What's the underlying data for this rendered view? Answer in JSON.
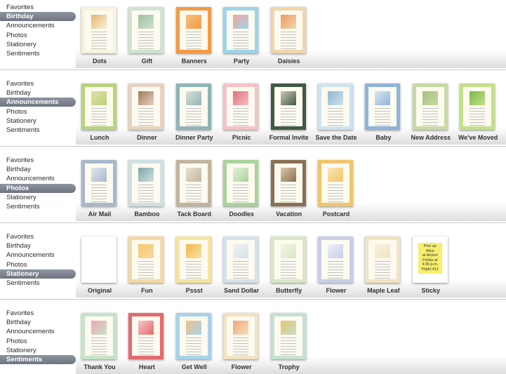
{
  "rows": [
    {
      "categories": [
        "Favorites",
        "Birthday",
        "Announcements",
        "Photos",
        "Stationery",
        "Sentiments"
      ],
      "selected": 1,
      "templates": [
        {
          "label": "Dots",
          "bg": "#f7f2dd",
          "accent": "#e8b36c"
        },
        {
          "label": "Gift",
          "bg": "#cfe3d2",
          "accent": "#9cbfa3"
        },
        {
          "label": "Banners",
          "bg": "#f39a44",
          "accent": "#f6c27a"
        },
        {
          "label": "Party",
          "bg": "#9fd4e8",
          "accent": "#f2a7a0"
        },
        {
          "label": "Daisies",
          "bg": "#f1d6ad",
          "accent": "#e89b63"
        }
      ]
    },
    {
      "categories": [
        "Favorites",
        "Birthday",
        "Announcements",
        "Photos",
        "Stationery",
        "Sentiments"
      ],
      "selected": 2,
      "templates": [
        {
          "label": "Lunch",
          "bg": "#b7d47d",
          "accent": "#e8dca8"
        },
        {
          "label": "Dinner",
          "bg": "#e7d2c0",
          "accent": "#9e7a5b"
        },
        {
          "label": "Dinner Party",
          "bg": "#8fb4b7",
          "accent": "#d9e2d8"
        },
        {
          "label": "Picnic",
          "bg": "#f3c3c6",
          "accent": "#e26e7a"
        },
        {
          "label": "Formal Invite",
          "bg": "#3f5a46",
          "accent": "#cfc9b8"
        },
        {
          "label": "Save the Date",
          "bg": "#cfe3ee",
          "accent": "#8fb6cc"
        },
        {
          "label": "Baby",
          "bg": "#8eb5d8",
          "accent": "#d8e6f2"
        },
        {
          "label": "New Address",
          "bg": "#c8d9a6",
          "accent": "#a6c07a"
        },
        {
          "label": "We've Moved",
          "bg": "#c4e08a",
          "accent": "#79b94a"
        }
      ]
    },
    {
      "categories": [
        "Favorites",
        "Birthday",
        "Announcements",
        "Photos",
        "Stationery",
        "Sentiments"
      ],
      "selected": 3,
      "templates": [
        {
          "label": "Air Mail",
          "bg": "#a7b8cc",
          "accent": "#e0e6ee"
        },
        {
          "label": "Bamboo",
          "bg": "#cfe0e2",
          "accent": "#7fa7a8"
        },
        {
          "label": "Tack Board",
          "bg": "#c3b49d",
          "accent": "#e9e2d3"
        },
        {
          "label": "Doodles",
          "bg": "#a8d39a",
          "accent": "#e7f0db"
        },
        {
          "label": "Vacation",
          "bg": "#8b6f52",
          "accent": "#d9c7a8"
        },
        {
          "label": "Postcard",
          "bg": "#f1c56a",
          "accent": "#fbe6b3"
        }
      ]
    },
    {
      "categories": [
        "Favorites",
        "Birthday",
        "Announcements",
        "Photos",
        "Stationery",
        "Sentiments"
      ],
      "selected": 4,
      "templates": [
        {
          "label": "Original",
          "bg": "#ffffff",
          "accent": "#ffffff"
        },
        {
          "label": "Fun",
          "bg": "#f4d9a5",
          "accent": "#f7c86a"
        },
        {
          "label": "Pssst",
          "bg": "#f6e4a2",
          "accent": "#f4b64a"
        },
        {
          "label": "Sand Dollar",
          "bg": "#d5e2ea",
          "accent": "#eef3f5"
        },
        {
          "label": "Butterfly",
          "bg": "#d9e7c4",
          "accent": "#f1f5e4"
        },
        {
          "label": "Flower",
          "bg": "#c9cde8",
          "accent": "#eef0fa"
        },
        {
          "label": "Maple Leaf",
          "bg": "#f2e3c3",
          "accent": "#f9f1de"
        },
        {
          "label": "Sticky",
          "bg": "#ffffff",
          "accent": "#f7ef6d"
        }
      ]
    },
    {
      "categories": [
        "Favorites",
        "Birthday",
        "Announcements",
        "Photos",
        "Stationery",
        "Sentiments"
      ],
      "selected": 5,
      "templates": [
        {
          "label": "Thank You",
          "bg": "#c6e3c9",
          "accent": "#f1a6b4"
        },
        {
          "label": "Heart",
          "bg": "#e26a6c",
          "accent": "#f7c7c7"
        },
        {
          "label": "Get Well",
          "bg": "#a6d3ea",
          "accent": "#f2c08a"
        },
        {
          "label": "Flower",
          "bg": "#f3e2c2",
          "accent": "#f0a37b"
        },
        {
          "label": "Trophy",
          "bg": "#c6e0d1",
          "accent": "#e6c36a"
        }
      ]
    }
  ],
  "sticky_note": {
    "line1": "Pick up Alice",
    "line2": "at Airport",
    "line3": "Friday at",
    "line4": "4:30 p.m.",
    "line5": "Flight 411"
  }
}
